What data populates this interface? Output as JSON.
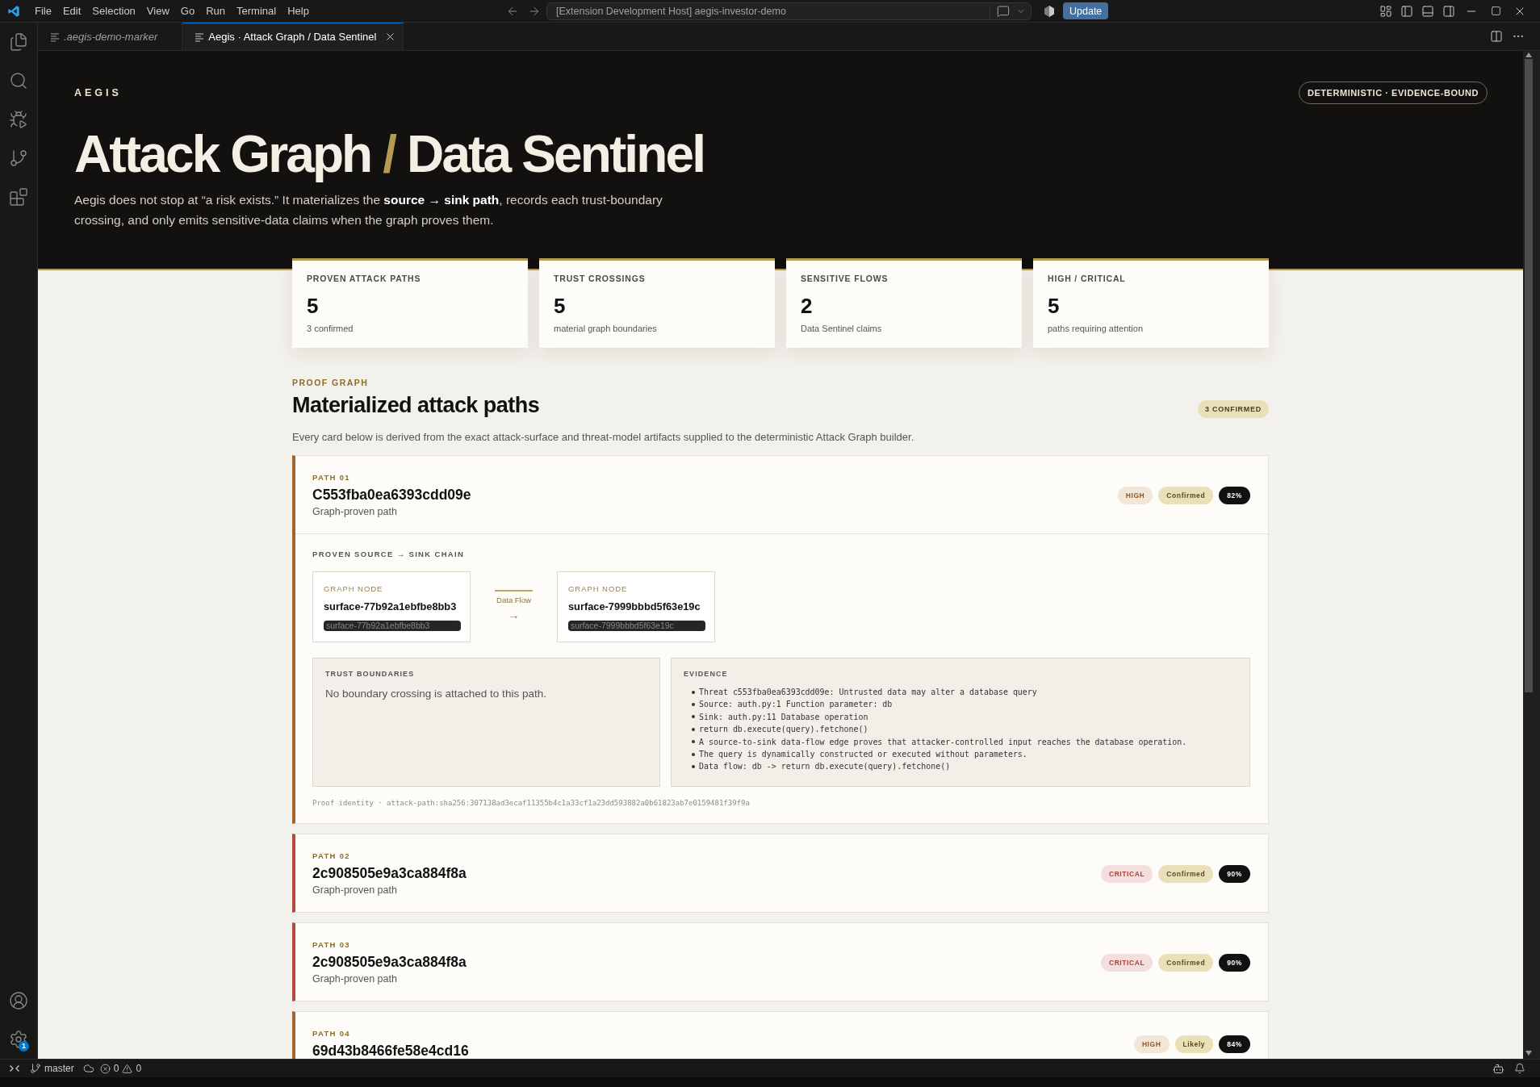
{
  "title_bar": {
    "menu": [
      "File",
      "Edit",
      "Selection",
      "View",
      "Go",
      "Run",
      "Terminal",
      "Help"
    ],
    "command_center": "[Extension Development Host] aegis-investor-demo",
    "update_button": "Update"
  },
  "activity_bar": {
    "settings_badge": "1"
  },
  "tabs": [
    {
      "label": ".aegis-demo-marker",
      "selected": false,
      "preview": true
    },
    {
      "label": "Aegis · Attack Graph / Data Sentinel",
      "selected": true,
      "preview": false
    }
  ],
  "hero": {
    "brand": "AEGIS",
    "badge": "DETERMINISTIC · EVIDENCE-BOUND",
    "title": "Attack Graph",
    "title_separator": "/",
    "title_suffix": "Data Sentinel",
    "intro": "Aegis does not stop at “a risk exists.” It materializes the **source → sink path**, records each trust-boundary crossing, and only emits sensitive-data claims when the graph proves them."
  },
  "stats": [
    {
      "label": "PROVEN ATTACK PATHS",
      "value": "5",
      "note": "3 confirmed"
    },
    {
      "label": "TRUST CROSSINGS",
      "value": "5",
      "note": "material graph boundaries"
    },
    {
      "label": "SENSITIVE FLOWS",
      "value": "2",
      "note": "Data Sentinel claims"
    },
    {
      "label": "HIGH / CRITICAL",
      "value": "5",
      "note": "paths requiring attention"
    }
  ],
  "section": {
    "eyebrow": "PROOF GRAPH",
    "title": "Materialized attack paths",
    "badge": "3 CONFIRMED",
    "description": "Every card below is derived from the exact attack-surface and threat-model artifacts supplied to the deterministic Attack Graph builder."
  },
  "paths": [
    {
      "kind": "high",
      "label": "PATH 01",
      "title": "C553fba0ea6393cdd09e",
      "subtitle": "Graph-proven path",
      "severity": "HIGH",
      "status": "Confirmed",
      "confidence": "82%",
      "expanded": true,
      "details": {
        "chain_heading": "PROVEN SOURCE → SINK CHAIN",
        "nodes": [
          {
            "label": "GRAPH NODE",
            "name": "surface-77b92a1ebfbe8bb3",
            "id": "surface-77b92a1ebfbe8bb3"
          },
          {
            "label": "GRAPH NODE",
            "name": "surface-7999bbbd5f63e19c",
            "id": "surface-7999bbbd5f63e19c"
          }
        ],
        "edge": {
          "label": "Data Flow",
          "arrow": "→"
        },
        "trust_boundaries": {
          "heading": "TRUST BOUNDARIES",
          "text": "No boundary crossing is attached to this path."
        },
        "evidence": {
          "heading": "EVIDENCE",
          "items": [
            "Threat c553fba0ea6393cdd09e: Untrusted data may alter a database query",
            "Source: auth.py:1 Function parameter: db",
            "Sink: auth.py:11 Database operation",
            "return db.execute(query).fetchone()",
            "A source-to-sink data-flow edge proves that attacker-controlled input reaches the database operation.",
            "The query is dynamically constructed or executed without parameters.",
            "Data flow: db -> return db.execute(query).fetchone()"
          ]
        },
        "proof_identity": "Proof identity · attack-path:sha256:307138ad3ecaf11355b4c1a33cf1a23dd593882a0b61823ab7e0159481f39f9a"
      }
    },
    {
      "kind": "critical",
      "label": "PATH 02",
      "title": "2c908505e9a3ca884f8a",
      "subtitle": "Graph-proven path",
      "severity": "CRITICAL",
      "status": "Confirmed",
      "confidence": "90%",
      "expanded": false
    },
    {
      "kind": "critical",
      "label": "PATH 03",
      "title": "2c908505e9a3ca884f8a",
      "subtitle": "Graph-proven path",
      "severity": "CRITICAL",
      "status": "Confirmed",
      "confidence": "90%",
      "expanded": false
    },
    {
      "kind": "high",
      "label": "PATH 04",
      "title": "69d43b8466fe58e4cd16",
      "severity": "HIGH",
      "status": "Likely",
      "confidence": "84%",
      "expanded": false
    }
  ],
  "status_bar": {
    "branch": "master",
    "errors": "0",
    "warnings": "0"
  }
}
